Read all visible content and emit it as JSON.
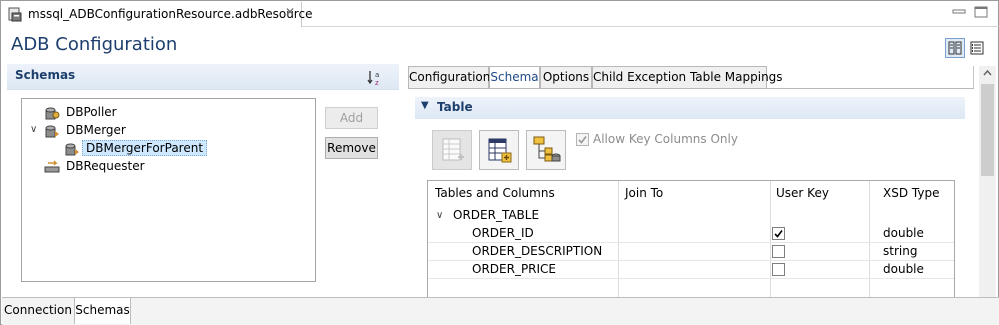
{
  "editor_tab": {
    "title": "mssql_ADBConfigurationResource.adbResource",
    "close_glyph": "✕",
    "icon": "adb-resource-file-icon"
  },
  "page": {
    "title": "ADB Configuration"
  },
  "schemas": {
    "header": "Schemas",
    "sort_icon": "sort-az-icon",
    "tree": [
      {
        "label": "DBPoller",
        "icon": "db-poller-icon",
        "expandable": false,
        "selected": false
      },
      {
        "label": "DBMerger",
        "icon": "db-merger-icon",
        "expanded": true,
        "selected": false
      },
      {
        "label": "DBMergerForParent",
        "icon": "db-merger-icon",
        "child": true,
        "selected": true
      },
      {
        "label": "DBRequester",
        "icon": "db-requester-icon",
        "expandable": false,
        "selected": false
      }
    ],
    "add_label": "Add",
    "remove_label": "Remove"
  },
  "tabs": [
    {
      "label": "Configuration",
      "active": false
    },
    {
      "label": "Schema",
      "active": true
    },
    {
      "label": "Options",
      "active": false
    },
    {
      "label": "Child Exception Table Mappings",
      "active": false
    }
  ],
  "table_section": {
    "header": "Table",
    "toolbar": [
      "add-table-icon",
      "add-column-table-icon",
      "key-columns-icon"
    ],
    "allow_key_columns_only": {
      "label": "Allow Key Columns Only",
      "checked": true,
      "enabled": false
    }
  },
  "grid": {
    "columns": [
      "Tables and Columns",
      "Join To",
      "User Key",
      "XSD Type"
    ],
    "table": {
      "name": "ORDER_TABLE",
      "expanded": true
    },
    "rows": [
      {
        "name": "ORDER_ID",
        "join_to": "",
        "user_key": true,
        "xsd_type": "double"
      },
      {
        "name": "ORDER_DESCRIPTION",
        "join_to": "",
        "user_key": false,
        "xsd_type": "string"
      },
      {
        "name": "ORDER_PRICE",
        "join_to": "",
        "user_key": false,
        "xsd_type": "double"
      }
    ]
  },
  "bottom_tabs": [
    {
      "label": "Connection",
      "active": false
    },
    {
      "label": "Schemas",
      "active": true
    }
  ],
  "colors": {
    "title": "#1d3f6d",
    "accent": "#1f4a86",
    "selection": "#cde8ff"
  }
}
